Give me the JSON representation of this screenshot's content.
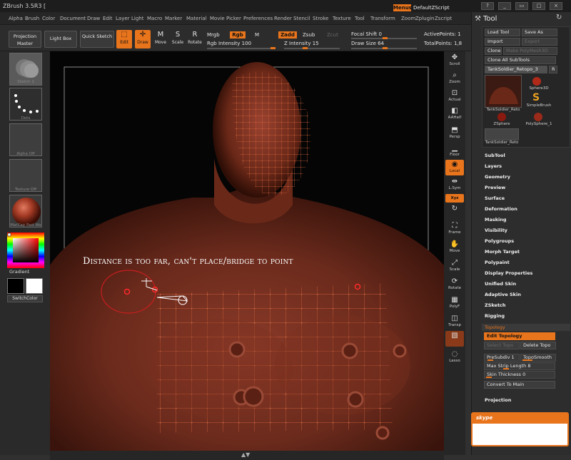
{
  "app": {
    "title": "ZBrush 3.5R3 ["
  },
  "menu": {
    "items": [
      "Alpha",
      "Brush",
      "Color",
      "Document",
      "Draw",
      "Edit",
      "Layer",
      "Light",
      "Macro",
      "Marker",
      "Material",
      "Movie",
      "Picker",
      "Preferences",
      "Render",
      "Stencil",
      "Stroke",
      "Texture",
      "Tool",
      "Transform",
      "Zoom",
      "Zplugin",
      "Zscript"
    ],
    "menus_label": "Menus",
    "script_label": "DefaultZScript"
  },
  "toolbar": {
    "projection_master": "Projection Master",
    "light_box": "Light Box",
    "quick_sketch": "Quick Sketch",
    "edit": "Edit",
    "draw": "Draw",
    "move": "Move",
    "scale": "Scale",
    "rotate": "Rotate",
    "mrgb": "Mrgb",
    "rgb": "Rgb",
    "m": "M",
    "zadd": "Zadd",
    "zsub": "Zsub",
    "zcut": "Zcut",
    "rgb_intensity": "Rgb Intensity 100",
    "z_intensity": "Z Intensity 15",
    "focal_shift": "Focal Shift 0",
    "draw_size": "Draw Size 64",
    "active_points": "ActivePoints: 1",
    "total_points": "TotalPoints: 1,8"
  },
  "left_shelf": {
    "brush_label": "Sketch 1",
    "stroke_label": "Dots",
    "alpha_label": "Alpha Off",
    "texture_label": "Texture Off",
    "material_label": "MatCap Red Wa",
    "gradient": "Gradient",
    "switch_color": "SwitchColor"
  },
  "canvas": {
    "annotation": "Distance is too far, can't place/bridge to point"
  },
  "icon_strip": [
    {
      "label": "Scroll",
      "icon": "scroll-icon"
    },
    {
      "label": "Zoom",
      "icon": "zoom-icon"
    },
    {
      "label": "Actual",
      "icon": "actual-icon"
    },
    {
      "label": "AAHalf",
      "icon": "aahalf-icon"
    },
    {
      "label": "Persp",
      "icon": "persp-icon"
    },
    {
      "label": "Floor",
      "icon": "floor-icon"
    },
    {
      "label": "Local",
      "icon": "local-icon",
      "active": true
    },
    {
      "label": "L.Sym",
      "icon": "lsym-icon"
    },
    {
      "label": "Xyz",
      "icon": "xyz-icon",
      "active": true
    },
    {
      "label": "",
      "icon": "rotate-y-icon"
    },
    {
      "label": "Frame",
      "icon": "frame-icon"
    },
    {
      "label": "Move",
      "icon": "move-icon"
    },
    {
      "label": "Scale",
      "icon": "scale-icon"
    },
    {
      "label": "Rotate",
      "icon": "rotate-icon"
    },
    {
      "label": "PolyF",
      "icon": "polyf-icon"
    },
    {
      "label": "Transp",
      "icon": "transp-icon"
    },
    {
      "label": "",
      "icon": "ghost-icon",
      "active": true
    },
    {
      "label": "Lasso",
      "icon": "lasso-icon"
    }
  ],
  "tool_panel": {
    "title": "Tool",
    "load_tool": "Load Tool",
    "save_as": "Save As",
    "import": "Import",
    "export": "Export",
    "clone": "Clone",
    "make_polymesh": "Make PolyMesh3D",
    "clone_all": "Clone All SubTools",
    "current_tool": "TankSoldier_Retopo_3",
    "r": "R",
    "tools": [
      {
        "name": "TankSoldier_Reto",
        "kind": "big"
      },
      {
        "name": "Sphere3D",
        "kind": "sphere"
      },
      {
        "name": "SimpleBrush",
        "kind": "brush"
      },
      {
        "name": "ZSphere",
        "kind": "zsphere"
      },
      {
        "name": "PolySphere_1",
        "kind": "polysphere"
      },
      {
        "name": "TankSoldier_Reto",
        "kind": "small"
      }
    ],
    "sections": [
      "SubTool",
      "Layers",
      "Geometry",
      "Preview",
      "Surface",
      "Deformation",
      "Masking",
      "Visibility",
      "Polygroups",
      "Morph Target",
      "Polypaint",
      "Display Properties",
      "Unified Skin",
      "Adaptive Skin",
      "ZSketch",
      "Rigging"
    ],
    "topology": "Topology",
    "edit_topology": "Edit Topology",
    "select_topo": "Select Topo",
    "delete_topo": "Delete Topo",
    "presubdiv": "PreSubdiv 1",
    "topo_smooth": "TopoSmooth",
    "max_strip": "Max Strip Length 8",
    "skin_thickness": "Skin Thickness 0",
    "convert_to_main": "Convert To Main",
    "projection": "Projection"
  },
  "skype": {
    "label": "skype"
  },
  "colors": {
    "accent": "#e8741c",
    "mesh": "#7a3324",
    "wire": "#d8643a"
  }
}
